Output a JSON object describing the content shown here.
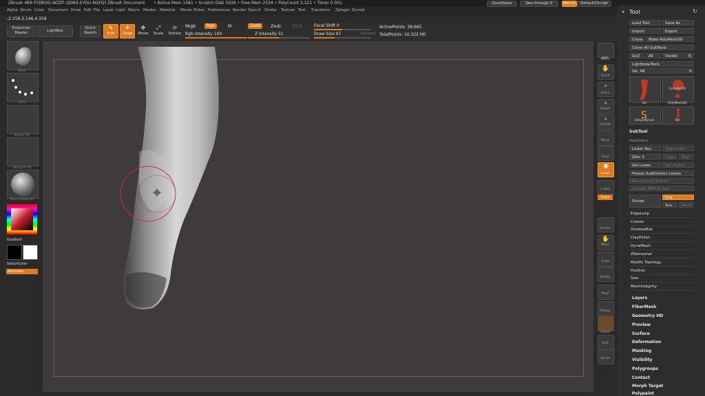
{
  "title_bar": {
    "app": "ZBrush 4R6 P2[BOIG-WZZF-QDN3-EYDU-NGFQ]",
    "document": "ZBrush Document",
    "stats": "• Active Mem 1581 • Scratch Disk 5026 • Free Mem 2534 • PolyCount 2,321 • Timer 0.001"
  },
  "menu": [
    "Alpha",
    "Brush",
    "Color",
    "Document",
    "Draw",
    "Edit",
    "File",
    "Layer",
    "Light",
    "Macro",
    "Marker",
    "Material",
    "Movie",
    "Picker",
    "Preferences",
    "Render",
    "Stencil",
    "Stroke",
    "Texture",
    "Tool",
    "Transform",
    "Zplugin",
    "Zscript"
  ],
  "top_right": {
    "quicksave": "QuickSave",
    "seethrough": "See-through 0",
    "menus": "Menus",
    "script": "DefaultZScript"
  },
  "coords": "-2.258,3.146,4.358",
  "toolbar": {
    "projection_master": "Projection Master",
    "lightbox": "LightBox",
    "quick_sketch": "Quick Sketch",
    "edit": "Edit",
    "draw": "Draw",
    "move": "Move",
    "scale": "Scale",
    "rotate": "Rotate",
    "mrgb": "Mrgb",
    "rgb": "Rgb",
    "m": "M",
    "rgb_intensity": "Rgb Intensity 100",
    "zadd": "Zadd",
    "zsub": "Zsub",
    "zcut": "Zcut",
    "z_intensity": "Z Intensity 51",
    "focal_shift": "Focal Shift 0",
    "draw_size": "Draw Size 97",
    "dynamic": "Dynamic",
    "active_points": "ActivePoints: 39,665",
    "total_points": "TotalPoints: 10.322 Mil"
  },
  "left_shelf": {
    "brush_caption": "Blob",
    "stroke_caption": "Dots",
    "alpha_caption": "Alpha Off",
    "texture_caption": "Texture Off",
    "material_caption": "BasicMaterial",
    "gradient": "Gradient",
    "switch_color": "SwitchColor",
    "alternate": "Alternate"
  },
  "right_icons": [
    "BPR",
    "SPix 3",
    "Scroll",
    "Zoom",
    "Actual",
    "AAHalf",
    "Persp",
    "Floor",
    "Local",
    "L.Sym",
    "Gxyz",
    "Frame",
    "Move",
    "Scale",
    "Rotate",
    "PolyF",
    "Transp",
    "Ghost",
    "Solo",
    "Xpose"
  ],
  "tool_panel": {
    "header": "Tool",
    "load_tool": "Load Tool",
    "save_as": "Save As",
    "import": "Import",
    "export": "Export",
    "clone": "Clone",
    "make_polymesh": "Make PolyMesh3D",
    "clone_all": "Clone All SubTools",
    "goz": "GoZ",
    "all": "All",
    "visible": "Visible",
    "r": "R",
    "lightbox_tools": "Lightbox▸Tools",
    "list_value": "list. 48",
    "tools": [
      "list",
      "Cylinder3D",
      "list",
      "PolyMesh3D",
      "SimpleBrush",
      "list"
    ],
    "subtool": "SubTool",
    "geometry": "Geometry",
    "lower_res": "Lower Res",
    "higher_res": "Higher Res",
    "sdiv": "SDiv 3",
    "cage": "Cage",
    "rstr": "Rstr",
    "del_lower": "Del Lower",
    "del_higher": "Del Higher",
    "freeze": "Freeze SubDivision Levels",
    "reconstruct": "Reconstruct Subdiv",
    "convert_bpr": "Convert BPR To Geo",
    "divide": "Divide",
    "smt": "Smt",
    "suv": "Suv",
    "reuv": "ReUV",
    "geometry_subs": [
      "EdgeLoop",
      "Crease",
      "ShadowBox",
      "ClayPolish",
      "DynaMesh",
      "ZRemesher",
      "Modify Topology",
      "Position",
      "Size",
      "MeshIntegrity"
    ],
    "sections": [
      "Layers",
      "FiberMesh",
      "Geometry HD",
      "Preview",
      "Surface",
      "Deformation",
      "Masking",
      "Visibility",
      "Polygroups",
      "Contact",
      "Morph Target",
      "Polypaint"
    ]
  },
  "colors": {
    "accent": "#e07a1e",
    "canvas": "#3f3a3b",
    "brush_circle": "#c2303a"
  }
}
